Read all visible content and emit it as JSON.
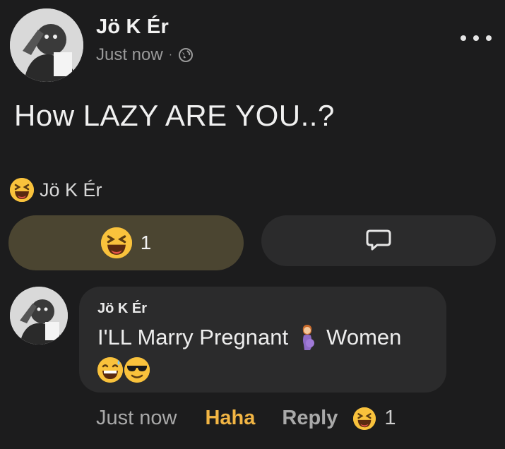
{
  "post": {
    "author": "Jö K Ér",
    "time": "Just now",
    "separator": "·",
    "privacy_icon": "globe-icon",
    "more_icon": "more-options-icon",
    "text": "How LAZY ARE YOU..?"
  },
  "reactions": {
    "emoji": "laughing-emoji-icon",
    "reactor_name": "Jö K Ér"
  },
  "actions": {
    "react_emoji": "laughing-emoji-icon",
    "react_count": "1",
    "comment_icon": "comment-bubble-icon"
  },
  "comment": {
    "author": "Jö K Ér",
    "text_before": "I'LL Marry Pregnant",
    "text_emoji": "pregnant-woman-icon",
    "text_after": "Women",
    "emojis": [
      "sweat-smile-emoji-icon",
      "sunglasses-emoji-icon"
    ],
    "footer": {
      "time": "Just now",
      "haha_label": "Haha",
      "reply_label": "Reply",
      "reaction_emoji": "laughing-emoji-icon",
      "reaction_count": "1"
    }
  },
  "colors": {
    "background": "#1c1c1d",
    "bubble": "#2b2b2c",
    "reacted_button": "#4b4531",
    "haha_accent": "#f2b544",
    "emoji_yellow": "#f9c23c"
  }
}
